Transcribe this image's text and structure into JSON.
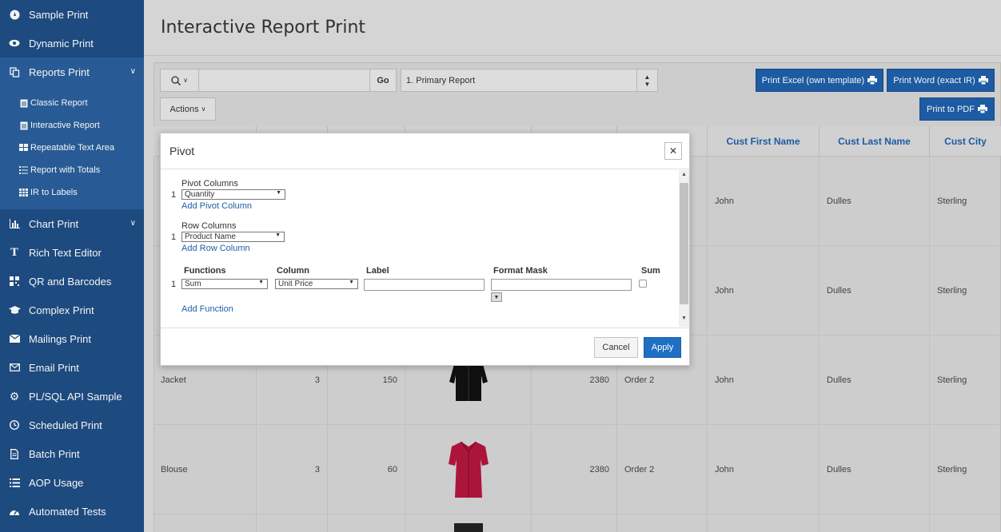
{
  "sidebar": {
    "items": [
      {
        "label": "Sample Print",
        "icon": "compass-icon"
      },
      {
        "label": "Dynamic Print",
        "icon": "eye-icon"
      },
      {
        "label": "Reports Print",
        "icon": "copy-icon"
      },
      {
        "label": "Chart Print",
        "icon": "bar-chart-icon"
      },
      {
        "label": "Rich Text Editor",
        "icon": "text-icon"
      },
      {
        "label": "QR and Barcodes",
        "icon": "qr-icon"
      },
      {
        "label": "Complex Print",
        "icon": "graduation-cap-icon"
      },
      {
        "label": "Mailings Print",
        "icon": "envelope-icon"
      },
      {
        "label": "Email Print",
        "icon": "envelope-outline-icon"
      },
      {
        "label": "PL/SQL API Sample",
        "icon": "gear-icon"
      },
      {
        "label": "Scheduled Print",
        "icon": "clock-icon"
      },
      {
        "label": "Batch Print",
        "icon": "file-icon"
      },
      {
        "label": "AOP Usage",
        "icon": "list-icon"
      },
      {
        "label": "Automated Tests",
        "icon": "dashboard-icon"
      }
    ],
    "subitems": [
      {
        "label": "Classic Report",
        "icon": "file-text-icon"
      },
      {
        "label": "Interactive Report",
        "icon": "file-text-icon"
      },
      {
        "label": "Repeatable Text Area",
        "icon": "grid-icon"
      },
      {
        "label": "Report with Totals",
        "icon": "list-ol-icon"
      },
      {
        "label": "IR to Labels",
        "icon": "table-icon"
      }
    ]
  },
  "page": {
    "title": "Interactive Report Print"
  },
  "toolbar": {
    "go_label": "Go",
    "report_select": "1. Primary Report",
    "actions_label": "Actions",
    "print_excel": "Print Excel (own template)",
    "print_word": "Print Word (exact IR)",
    "print_pdf": "Print to PDF"
  },
  "table": {
    "headers": [
      "Cust First Name",
      "Cust Last Name",
      "Cust City"
    ],
    "rows": [
      {
        "product": "",
        "qty": "",
        "price": "",
        "order_total": "",
        "order": "",
        "first": "John",
        "last": "Dulles",
        "city": "Sterling"
      },
      {
        "product": "",
        "qty": "",
        "price": "",
        "order_total": "",
        "order": "",
        "first": "John",
        "last": "Dulles",
        "city": "Sterling"
      },
      {
        "product": "Jacket",
        "qty": "3",
        "price": "150",
        "order_total": "2380",
        "order": "Order 2",
        "first": "John",
        "last": "Dulles",
        "city": "Sterling"
      },
      {
        "product": "Blouse",
        "qty": "3",
        "price": "60",
        "order_total": "2380",
        "order": "Order 2",
        "first": "John",
        "last": "Dulles",
        "city": "Sterling"
      }
    ]
  },
  "dialog": {
    "title": "Pivot",
    "pivot_columns_label": "Pivot Columns",
    "pivot_row_num": "1",
    "pivot_value": "Quantity",
    "add_pivot": "Add Pivot Column",
    "row_columns_label": "Row Columns",
    "row_row_num": "1",
    "row_value": "Product Name",
    "add_row": "Add Row Column",
    "fn_headers": {
      "functions": "Functions",
      "column": "Column",
      "label": "Label",
      "format_mask": "Format Mask",
      "sum": "Sum"
    },
    "fn_row_num": "1",
    "fn_value": "Sum",
    "fn_column": "Unit Price",
    "add_function": "Add Function",
    "cancel": "Cancel",
    "apply": "Apply"
  },
  "colors": {
    "sidebar": "#1f4e85",
    "accent": "#1f5fa9",
    "apply": "#1f6fc5"
  }
}
